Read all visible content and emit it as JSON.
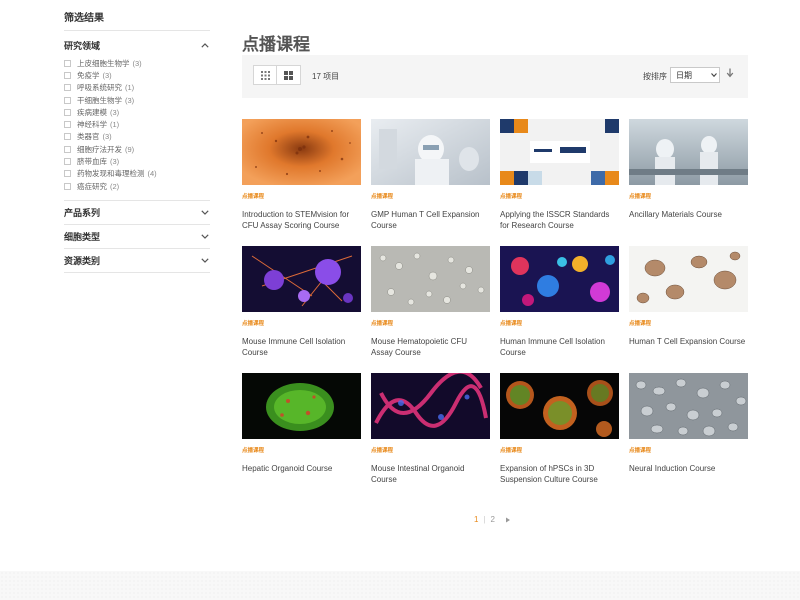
{
  "sidebar": {
    "title": "筛选结果",
    "sections": [
      {
        "label": "研究领域",
        "expanded": true,
        "options": [
          {
            "label": "上皮细胞生物学",
            "count": "(3)"
          },
          {
            "label": "免疫学",
            "count": "(3)"
          },
          {
            "label": "呼吸系统研究",
            "count": "(1)"
          },
          {
            "label": "干细胞生物学",
            "count": "(3)"
          },
          {
            "label": "疾病建模",
            "count": "(3)"
          },
          {
            "label": "神经科学",
            "count": "(1)"
          },
          {
            "label": "类器官",
            "count": "(3)"
          },
          {
            "label": "细胞疗法开发",
            "count": "(9)"
          },
          {
            "label": "脐带血库",
            "count": "(3)"
          },
          {
            "label": "药物发现和毒理检测",
            "count": "(4)"
          },
          {
            "label": "癌症研究",
            "count": "(2)"
          }
        ]
      },
      {
        "label": "产品系列",
        "expanded": false
      },
      {
        "label": "细胞类型",
        "expanded": false
      },
      {
        "label": "资源类别",
        "expanded": false
      }
    ]
  },
  "main": {
    "title": "点播课程",
    "toolbar": {
      "view_icons": [
        "grid-view-icon",
        "tile-view-icon"
      ],
      "item_count": "17 项目",
      "sort_label": "按排序",
      "sort_value": "日期",
      "sort_direction": "descending"
    },
    "card_tag": "点播课程",
    "cards": [
      {
        "title": "Introduction to STEMvision for CFU Assay Scoring Course",
        "image": "orange-cell-colony-micrograph"
      },
      {
        "title": "GMP Human T Cell Expansion Course",
        "image": "lab-scientist-cleanroom-photo"
      },
      {
        "title": "Applying the ISSCR Standards for Research Course",
        "image": "stemcell-isscr-banner"
      },
      {
        "title": "Ancillary Materials Course",
        "image": "lab-scientists-bench-photo"
      },
      {
        "title": "Mouse Immune Cell Isolation Course",
        "image": "purple-neuron-cells-render"
      },
      {
        "title": "Mouse Hematopoietic CFU Assay Course",
        "image": "gray-cell-colony-micrograph"
      },
      {
        "title": "Human Immune Cell Isolation Course",
        "image": "colorful-immune-cells-render"
      },
      {
        "title": "Human T Cell Expansion Course",
        "image": "t-cell-clusters-micrograph"
      },
      {
        "title": "Hepatic Organoid Course",
        "image": "green-hepatic-organoid-fluorescence"
      },
      {
        "title": "Mouse Intestinal Organoid Course",
        "image": "intestinal-organoid-fluorescence"
      },
      {
        "title": "Expansion of hPSCs in 3D Suspension Culture Course",
        "image": "hpsc-spheroids-fluorescence"
      },
      {
        "title": "Neural Induction Course",
        "image": "neural-cells-micrograph"
      }
    ]
  },
  "pagination": {
    "pages": [
      "1",
      "2"
    ],
    "current": "1",
    "separator": "|"
  },
  "colors": {
    "accent": "#e8891a",
    "toolbar_bg": "#f5f5f5",
    "title_gray": "#555555"
  }
}
